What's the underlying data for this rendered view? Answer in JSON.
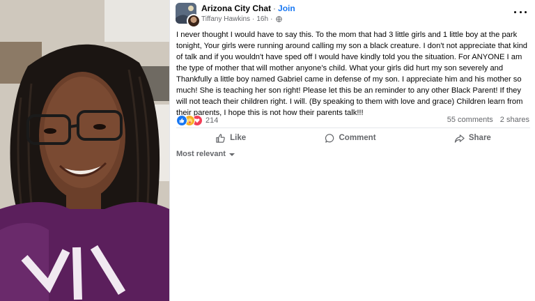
{
  "post": {
    "group_name": "Arizona City Chat",
    "separator": "·",
    "join_label": "Join",
    "author": "Tiffany Hawkins",
    "time_ago": "16h",
    "meta_dot": "·",
    "body": "I never thought I would have to say this. To the mom that had 3 little girls and 1 little boy at the park tonight, Your girls were running around calling my son a black creature. I don't not appreciate that kind of talk and if you wouldn't have sped off I would have kindly told you the situation. For ANYONE I am the type of mother that will mother anyone's child. What your girls did hurt my son severely and Thankfully a little boy named Gabriel came in defense of my son. I appreciate him and his mother so much! She is teaching her son right! Please let this be an reminder to any other Black Parent! If they will not teach their children right. I will. (By speaking to them with love and grace) Children learn from their parents, I hope this is not how their parents talk!!!",
    "reaction_count": "214",
    "comments": "55 comments",
    "shares": "2 shares"
  },
  "actions": {
    "like": "Like",
    "comment": "Comment",
    "share": "Share"
  },
  "sort": {
    "label": "Most relevant"
  },
  "icons": {
    "privacy": "globe-icon",
    "more": "more-options-icon",
    "like": "thumbs-up-icon",
    "comment": "comment-bubble-icon",
    "share": "share-arrow-icon",
    "reactions": [
      "like-reaction-icon",
      "care-reaction-icon",
      "love-reaction-icon"
    ]
  },
  "colors": {
    "accent": "#1877f2",
    "text": "#050505",
    "muted": "#65676b",
    "love": "#f33e58",
    "care": "#f7b125"
  }
}
